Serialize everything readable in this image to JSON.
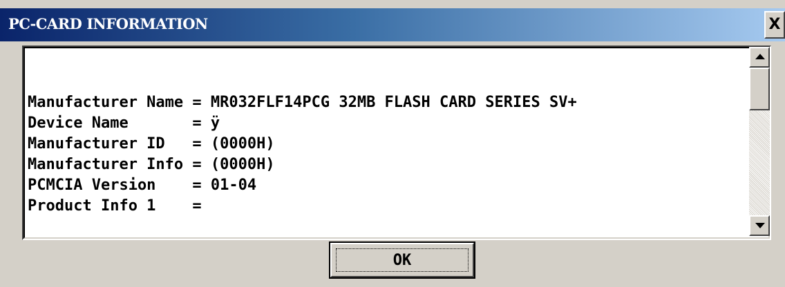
{
  "window": {
    "title": "PC-CARD INFORMATION",
    "close_label": "X"
  },
  "info": {
    "lines": [
      "Manufacturer Name = MR032FLF14PCG 32MB FLASH CARD SERIES SV+",
      "Device Name       = ÿ",
      "Manufacturer ID   = (0000H)",
      "Manufacturer Info = (0000H)",
      "PCMCIA Version    = 01-04",
      "Product Info 1    ="
    ]
  },
  "scrollbar": {
    "up_icon": "arrow-up-icon",
    "down_icon": "arrow-down-icon"
  },
  "buttons": {
    "ok_label": "OK"
  }
}
